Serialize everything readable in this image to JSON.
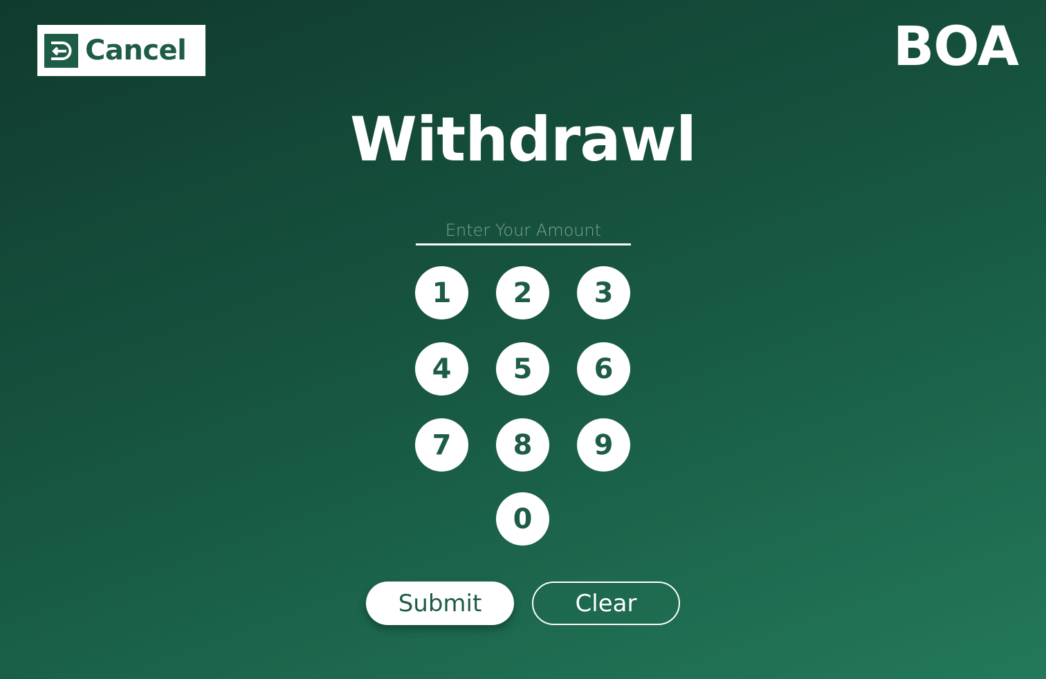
{
  "header": {
    "cancel_label": "Cancel",
    "cancel_icon": "logout-arrow-icon",
    "brand": "BOA"
  },
  "title": "Withdrawl",
  "amount_input": {
    "value": "",
    "placeholder": "Enter Your Amount"
  },
  "keypad": {
    "keys": [
      "1",
      "2",
      "3",
      "4",
      "5",
      "6",
      "7",
      "8",
      "9",
      "0"
    ]
  },
  "actions": {
    "submit_label": "Submit",
    "clear_label": "Clear"
  },
  "colors": {
    "accent": "#1d5c45",
    "background_start": "#103a2e",
    "background_end": "#23795a",
    "text_light": "#ffffff"
  }
}
